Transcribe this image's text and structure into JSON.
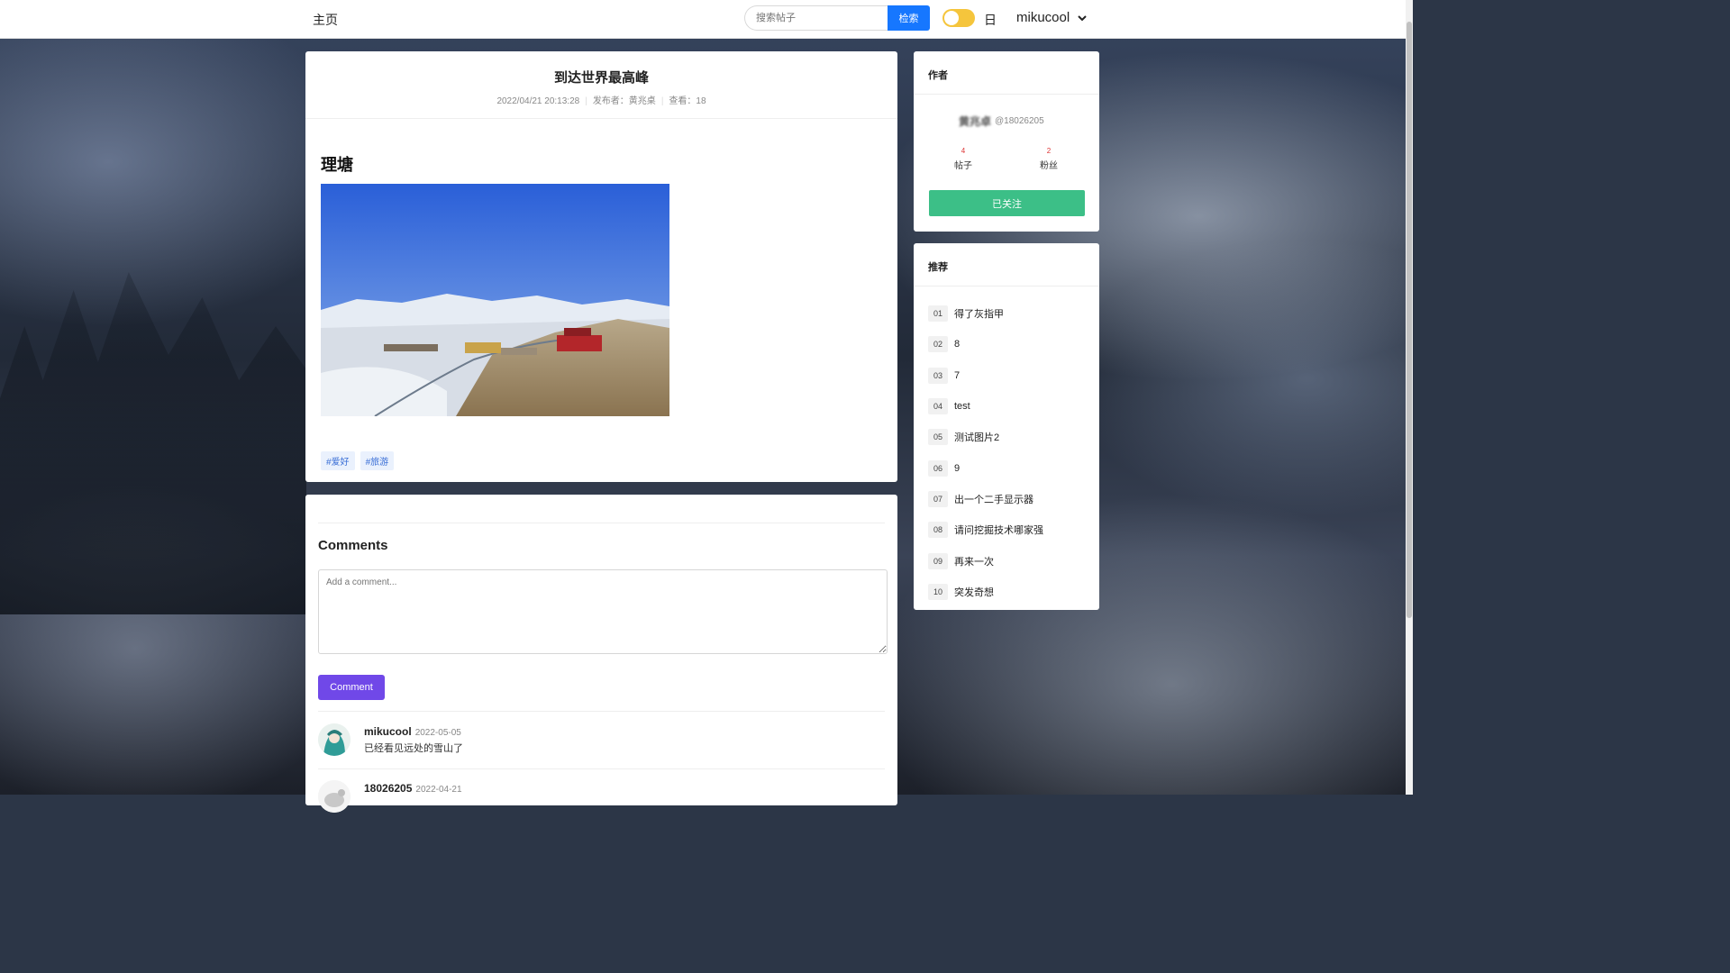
{
  "nav": {
    "home": "主页",
    "search_placeholder": "搜索帖子",
    "search_button": "检索",
    "theme_label": "日",
    "username": "mikucool"
  },
  "post": {
    "title": "到达世界最高峰",
    "datetime": "2022/04/21 20:13:28",
    "publisher": "发布者：黄兆桌",
    "views": "查看：18",
    "heading": "理塘",
    "tags": [
      "#爱好",
      "#旅游"
    ]
  },
  "comments": {
    "title": "Comments",
    "placeholder": "Add a comment...",
    "submit_label": "Comment",
    "items": [
      {
        "user": "mikucool",
        "date": "2022-05-05",
        "text": "已经看见远处的雪山了"
      },
      {
        "user": "18026205",
        "date": "2022-04-21",
        "text": ""
      }
    ]
  },
  "author": {
    "title": "作者",
    "name": "黄兆卓",
    "handle": "@18026205",
    "posts_count": "4",
    "posts_label": "帖子",
    "fans_count": "2",
    "fans_label": "粉丝",
    "follow_label": "已关注"
  },
  "recommend": {
    "title": "推荐",
    "items": [
      {
        "num": "01",
        "label": "得了灰指甲"
      },
      {
        "num": "02",
        "label": "8"
      },
      {
        "num": "03",
        "label": "7"
      },
      {
        "num": "04",
        "label": "test"
      },
      {
        "num": "05",
        "label": "测试图片2"
      },
      {
        "num": "06",
        "label": "9"
      },
      {
        "num": "07",
        "label": "出一个二手显示器"
      },
      {
        "num": "08",
        "label": "请问挖掘技术哪家强"
      },
      {
        "num": "09",
        "label": "再来一次"
      },
      {
        "num": "10",
        "label": "突发奇想"
      }
    ]
  },
  "colors": {
    "search_button": "#1677ff",
    "toggle": "#f5c53c",
    "follow_button": "#3cbf87",
    "comment_button": "#7048e8",
    "tag_text": "#3b6fd6"
  }
}
